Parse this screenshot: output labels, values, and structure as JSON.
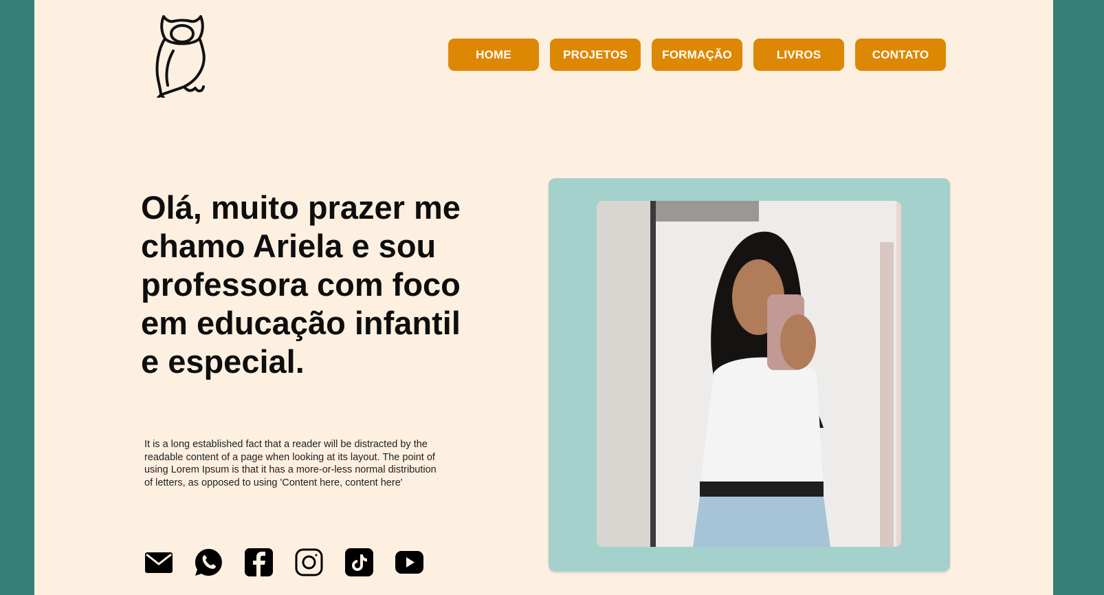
{
  "nav": {
    "items": [
      {
        "label": "HOME"
      },
      {
        "label": "PROJETOS"
      },
      {
        "label": "FORMAÇÃO"
      },
      {
        "label": "LIVROS"
      },
      {
        "label": "CONTATO"
      }
    ]
  },
  "hero": {
    "headline": "Olá, muito prazer me chamo Ariela e sou professora com foco em educação infantil e especial.",
    "body": "It is a long established fact that a reader will be distracted by the readable content of a page when looking at its layout. The point of using Lorem Ipsum is that it has a more-or-less normal distribution of letters, as opposed to using 'Content here, content here'"
  },
  "socials": [
    {
      "icon": "mail-icon"
    },
    {
      "icon": "whatsapp-icon"
    },
    {
      "icon": "facebook-icon"
    },
    {
      "icon": "instagram-icon"
    },
    {
      "icon": "tiktok-icon"
    },
    {
      "icon": "youtube-icon"
    }
  ],
  "colors": {
    "outer_background": "#367f78",
    "page_background": "#fdf0e1",
    "nav_button": "#dd8804",
    "photo_frame": "#a4d1cb",
    "text": "#0e0e0e"
  }
}
